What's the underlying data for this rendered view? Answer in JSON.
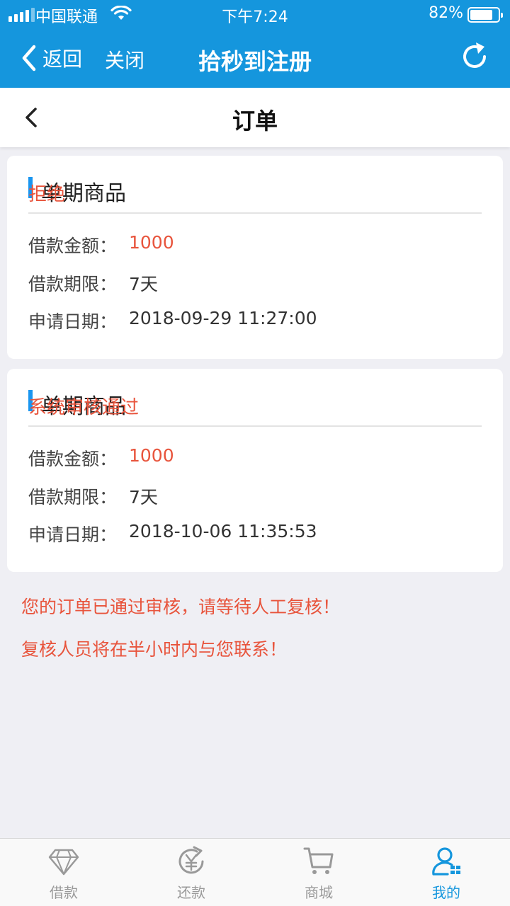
{
  "status_bar": {
    "carrier": "中国联通",
    "time": "下午7:24",
    "battery": "82%",
    "battery_level": 0.82
  },
  "nav": {
    "back_label": "返回",
    "close_label": "关闭",
    "title": "拾秒到注册"
  },
  "page": {
    "title": "订单"
  },
  "orders": [
    {
      "name": "单期商品",
      "status": "拒绝",
      "fields": [
        {
          "key": "借款金额：",
          "value": "1000"
        },
        {
          "key": "借款期限：",
          "value": "7天"
        },
        {
          "key": "申请日期：",
          "value": "2018-09-29 11:27:00"
        }
      ]
    },
    {
      "name": "单期商品",
      "status": "系统审核通过",
      "fields": [
        {
          "key": "借款金额：",
          "value": "1000"
        },
        {
          "key": "借款期限：",
          "value": "7天"
        },
        {
          "key": "申请日期：",
          "value": "2018-10-06 11:35:53"
        }
      ]
    }
  ],
  "notices": [
    "您的订单已通过审核，请等待人工复核！",
    "复核人员将在半小时内与您联系！"
  ],
  "tabs": [
    {
      "label": "借款",
      "icon": "diamond-icon"
    },
    {
      "label": "还款",
      "icon": "yen-cycle-icon"
    },
    {
      "label": "商城",
      "icon": "cart-icon"
    },
    {
      "label": "我的",
      "icon": "user-icon",
      "active": true
    }
  ],
  "colors": {
    "header_blue": "#1596dd",
    "accent_red": "#e8543c",
    "marker_blue": "#1a96f0"
  }
}
